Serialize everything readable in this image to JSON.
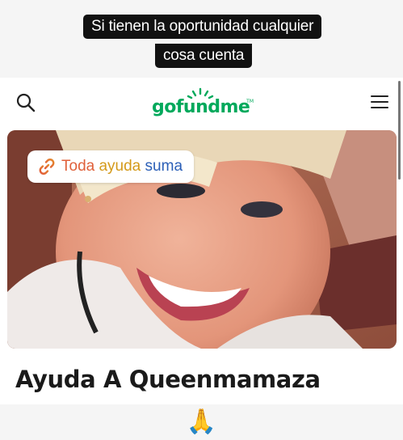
{
  "story_caption": {
    "line1": "Si tienen la oportunidad cualquier",
    "line2": "cosa cuenta"
  },
  "header": {
    "search_icon": "search-icon",
    "logo_text": "gofundme",
    "logo_tm": "TM",
    "menu_icon": "hamburger-menu-icon"
  },
  "hero": {
    "badge_icon": "link-icon",
    "badge_word1": "Toda",
    "badge_word2": "ayuda",
    "badge_word3": "suma"
  },
  "campaign": {
    "title": "Ayuda A Queenmamaza"
  },
  "footer": {
    "emoji": "🙏"
  },
  "colors": {
    "brand_green": "#02a95c",
    "caption_bg": "#111111"
  }
}
